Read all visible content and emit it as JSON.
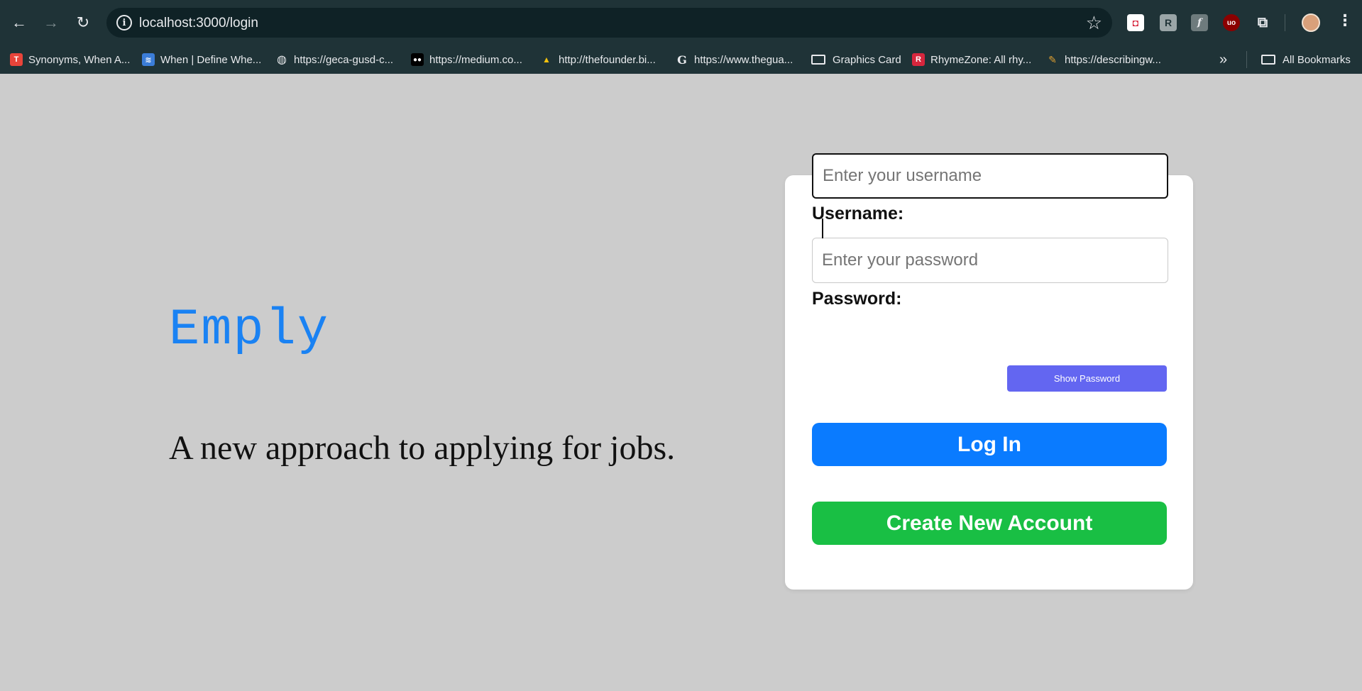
{
  "browser": {
    "url": "localhost:3000/login",
    "bookmarks": [
      {
        "label": "Synonyms, When A...",
        "icon": "thesaurus-icon",
        "color": "#e8443a",
        "glyph": "T"
      },
      {
        "label": "When | Define Whe...",
        "icon": "dictionary-icon",
        "color": "#3b7dd8",
        "glyph": "≋"
      },
      {
        "label": "https://geca-gusd-c...",
        "icon": "globe-icon",
        "color": "#1f3337",
        "glyph": "◍"
      },
      {
        "label": "https://medium.co...",
        "icon": "medium-icon",
        "color": "#000000",
        "glyph": "●"
      },
      {
        "label": "http://thefounder.bi...",
        "icon": "founder-icon",
        "color": "#1f3337",
        "glyph": "▲"
      },
      {
        "label": "https://www.thegua...",
        "icon": "guardian-icon",
        "color": "#1f3337",
        "glyph": "G"
      },
      {
        "label": "Graphics Card",
        "icon": "folder-icon",
        "color": "",
        "glyph": ""
      },
      {
        "label": "RhymeZone: All rhy...",
        "icon": "rhymezone-icon",
        "color": "#d7263d",
        "glyph": "R"
      },
      {
        "label": "https://describingw...",
        "icon": "describingwords-icon",
        "color": "#1f3337",
        "glyph": "✎"
      }
    ],
    "all_bookmarks_label": "All Bookmarks",
    "more_glyph": "»"
  },
  "hero": {
    "brand": "Emply",
    "tagline": "A new approach to applying for jobs."
  },
  "login": {
    "username_label": "Username:",
    "username_placeholder": "Enter your username",
    "password_label": "Password:",
    "password_placeholder": "Enter your password",
    "show_password_label": "Show Password",
    "login_label": "Log In",
    "create_label": "Create New Account"
  },
  "colors": {
    "brand": "#1a82f3",
    "login_button": "#0a7bff",
    "create_button": "#19bf44",
    "show_password_button": "#6366f1",
    "page_background": "#cccccc"
  }
}
